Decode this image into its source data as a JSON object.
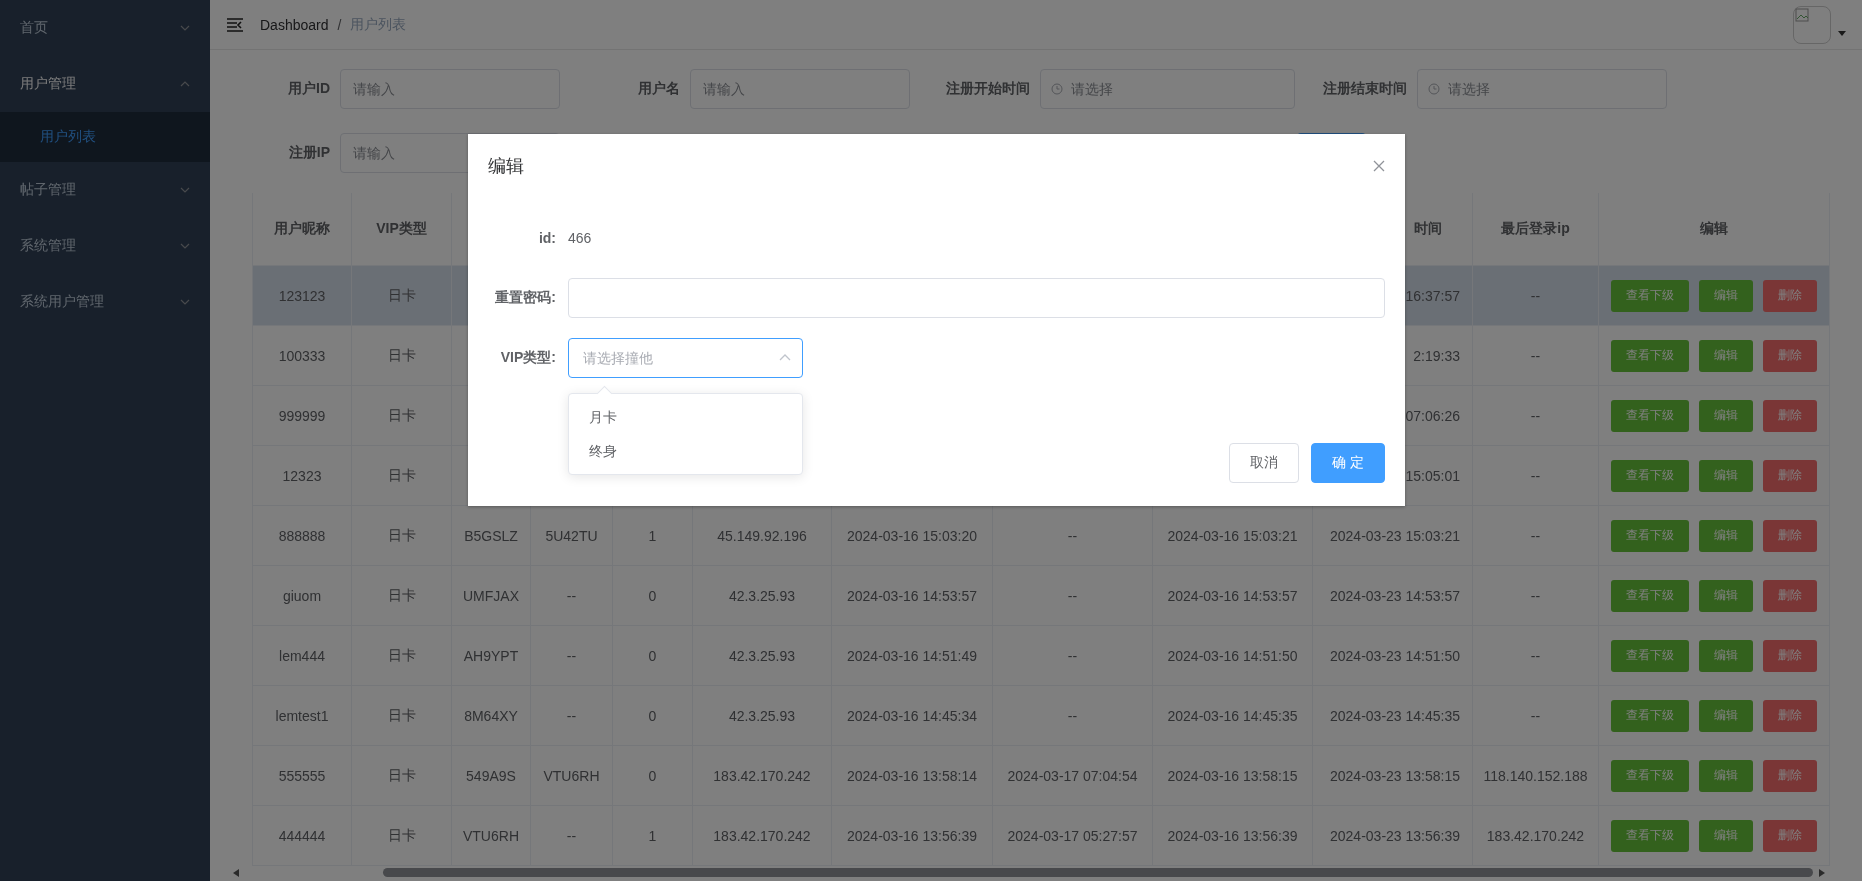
{
  "sidebar": {
    "items": [
      {
        "label": "首页",
        "expanded": false
      },
      {
        "label": "用户管理",
        "expanded": true,
        "children": [
          {
            "label": "用户列表",
            "selected": true
          }
        ]
      },
      {
        "label": "帖子管理",
        "expanded": false
      },
      {
        "label": "系统管理",
        "expanded": false
      },
      {
        "label": "系统用户管理",
        "expanded": false
      }
    ]
  },
  "breadcrumb": [
    "Dashboard",
    "用户列表"
  ],
  "breadcrumb_separator": "/",
  "filters": [
    {
      "label": "用户ID",
      "placeholder": "请输入",
      "kind": "text"
    },
    {
      "label": "用户名",
      "placeholder": "请输入",
      "kind": "text"
    },
    {
      "label": "注册开始时间",
      "placeholder": "请选择",
      "kind": "date"
    },
    {
      "label": "注册结束时间",
      "placeholder": "请选择",
      "kind": "date"
    },
    {
      "label": "注册IP",
      "placeholder": "请输入",
      "kind": "text"
    }
  ],
  "table": {
    "columns": [
      "用户昵称",
      "VIP类型",
      null,
      null,
      null,
      null,
      null,
      null,
      null,
      "时间",
      "最后登录ip",
      "编辑"
    ],
    "rows": [
      {
        "hovered": true,
        "cells": [
          "123123",
          "日卡",
          null,
          null,
          null,
          null,
          null,
          null,
          null,
          "16:37:57",
          "--"
        ],
        "actions": [
          {
            "label": "查看下级",
            "kind": "success"
          },
          {
            "label": "编辑",
            "kind": "success"
          },
          {
            "label": "删除",
            "kind": "danger"
          }
        ]
      },
      {
        "hovered": false,
        "cells": [
          "100333",
          "日卡",
          null,
          null,
          null,
          null,
          null,
          null,
          null,
          "2:19:33",
          "--"
        ],
        "actions": [
          {
            "label": "查看下级",
            "kind": "success"
          },
          {
            "label": "编辑",
            "kind": "success"
          },
          {
            "label": "删除",
            "kind": "danger"
          }
        ]
      },
      {
        "hovered": false,
        "cells": [
          "999999",
          "日卡",
          null,
          null,
          null,
          null,
          null,
          null,
          null,
          "07:06:26",
          "--"
        ],
        "actions": [
          {
            "label": "查看下级",
            "kind": "success"
          },
          {
            "label": "编辑",
            "kind": "success"
          },
          {
            "label": "删除",
            "kind": "danger"
          }
        ]
      },
      {
        "hovered": false,
        "cells": [
          "12323",
          "日卡",
          null,
          null,
          null,
          null,
          null,
          null,
          null,
          "15:05:01",
          "--"
        ],
        "actions": [
          {
            "label": "查看下级",
            "kind": "success"
          },
          {
            "label": "编辑",
            "kind": "success"
          },
          {
            "label": "删除",
            "kind": "danger"
          }
        ]
      },
      {
        "hovered": false,
        "cells": [
          "888888",
          "日卡",
          "B5GSLZ",
          "5U42TU",
          "1",
          "45.149.92.196",
          "2024-03-16 15:03:20",
          "--",
          "2024-03-16 15:03:21",
          "2024-03-23 15:03:21",
          "--"
        ],
        "actions": [
          {
            "label": "查看下级",
            "kind": "success"
          },
          {
            "label": "编辑",
            "kind": "success"
          },
          {
            "label": "删除",
            "kind": "danger"
          }
        ]
      },
      {
        "hovered": false,
        "cells": [
          "giuom",
          "日卡",
          "UMFJAX",
          "--",
          "0",
          "42.3.25.93",
          "2024-03-16 14:53:57",
          "--",
          "2024-03-16 14:53:57",
          "2024-03-23 14:53:57",
          "--"
        ],
        "actions": [
          {
            "label": "查看下级",
            "kind": "success"
          },
          {
            "label": "编辑",
            "kind": "success"
          },
          {
            "label": "删除",
            "kind": "danger"
          }
        ]
      },
      {
        "hovered": false,
        "cells": [
          "lem444",
          "日卡",
          "AH9YPT",
          "--",
          "0",
          "42.3.25.93",
          "2024-03-16 14:51:49",
          "--",
          "2024-03-16 14:51:50",
          "2024-03-23 14:51:50",
          "--"
        ],
        "actions": [
          {
            "label": "查看下级",
            "kind": "success"
          },
          {
            "label": "编辑",
            "kind": "success"
          },
          {
            "label": "删除",
            "kind": "danger"
          }
        ]
      },
      {
        "hovered": false,
        "cells": [
          "lemtest1",
          "日卡",
          "8M64XY",
          "--",
          "0",
          "42.3.25.93",
          "2024-03-16 14:45:34",
          "--",
          "2024-03-16 14:45:35",
          "2024-03-23 14:45:35",
          "--"
        ],
        "actions": [
          {
            "label": "查看下级",
            "kind": "success"
          },
          {
            "label": "编辑",
            "kind": "success"
          },
          {
            "label": "删除",
            "kind": "danger"
          }
        ]
      },
      {
        "hovered": false,
        "cells": [
          "555555",
          "日卡",
          "549A9S",
          "VTU6RH",
          "0",
          "183.42.170.242",
          "2024-03-16 13:58:14",
          "2024-03-17 07:04:54",
          "2024-03-16 13:58:15",
          "2024-03-23 13:58:15",
          "118.140.152.188"
        ],
        "actions": [
          {
            "label": "查看下级",
            "kind": "success"
          },
          {
            "label": "编辑",
            "kind": "success"
          },
          {
            "label": "删除",
            "kind": "danger"
          }
        ]
      },
      {
        "hovered": false,
        "cells": [
          "444444",
          "日卡",
          "VTU6RH",
          "--",
          "1",
          "183.42.170.242",
          "2024-03-16 13:56:39",
          "2024-03-17 05:27:57",
          "2024-03-16 13:56:39",
          "2024-03-23 13:56:39",
          "183.42.170.242"
        ],
        "actions": [
          {
            "label": "查看下级",
            "kind": "success"
          },
          {
            "label": "编辑",
            "kind": "success"
          },
          {
            "label": "删除",
            "kind": "danger"
          }
        ]
      }
    ]
  },
  "dialog": {
    "title": "编辑",
    "id_label": "id:",
    "id_value": "466",
    "password_label": "重置密码:",
    "vip_label": "VIP类型:",
    "vip_select": {
      "placeholder": "请选择撞他",
      "expanded": true,
      "options": [
        {
          "label": "月卡",
          "selected": false
        },
        {
          "label": "终身",
          "selected": false
        }
      ]
    },
    "buttons": [
      {
        "label": "取消",
        "kind": "default"
      },
      {
        "label": "确 定",
        "kind": "primary"
      }
    ]
  }
}
